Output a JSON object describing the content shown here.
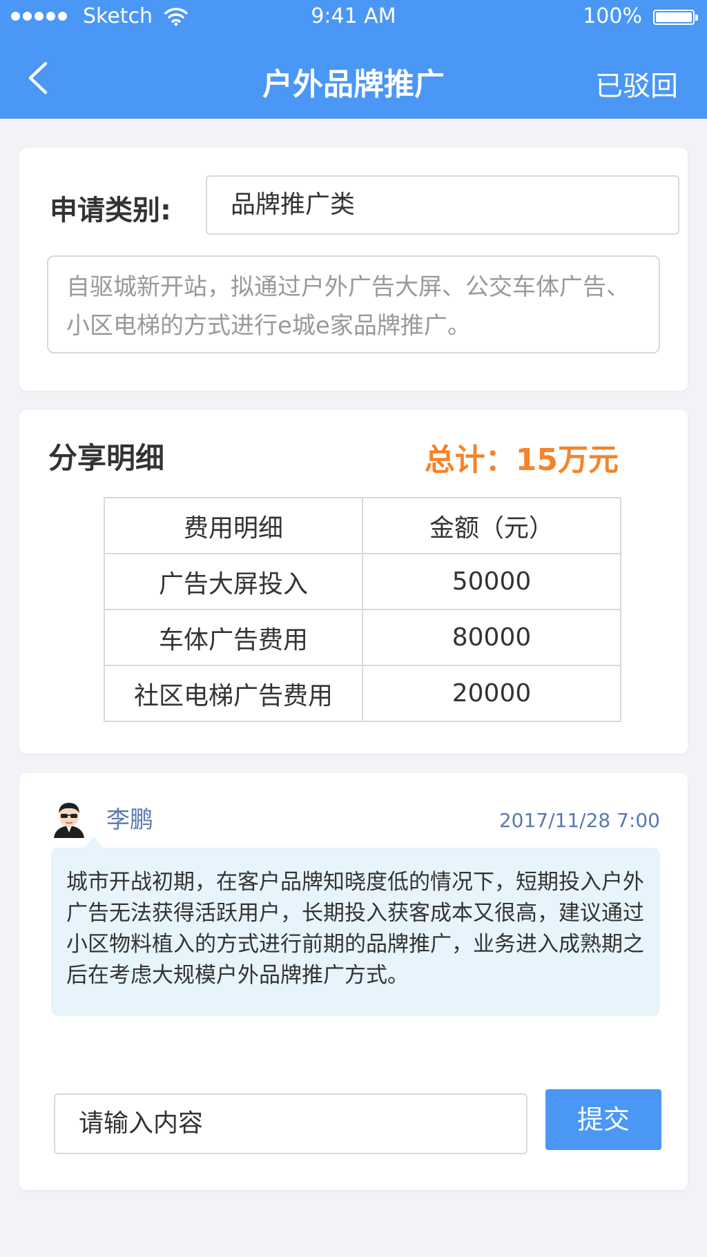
{
  "status_bar": {
    "carrier": "Sketch",
    "time": "9:41 AM",
    "battery": "100%"
  },
  "nav": {
    "title": "户外品牌推广",
    "right_action": "已驳回",
    "back_icon": "chevron-left-icon"
  },
  "application": {
    "category_label": "申请类别:",
    "category_value": "品牌推广类",
    "description": "自驱城新开站，拟通过户外广告大屏、公交车体广告、小区电梯的方式进行e城e家品牌推广。"
  },
  "share": {
    "title": "分享明细",
    "total": "总计：15万元",
    "headers": [
      "费用明细",
      "金额（元）"
    ],
    "rows": [
      [
        "广告大屏投入",
        "50000"
      ],
      [
        "车体广告费用",
        "80000"
      ],
      [
        "社区电梯广告费用",
        "20000"
      ]
    ]
  },
  "comment": {
    "user": "李鹏",
    "time": "2017/11/28 7:00",
    "text": "城市开战初期，在客户品牌知晓度低的情况下，短期投入户外广告无法获得活跃用户，长期投入获客成本又很高，建议通过小区物料植入的方式进行前期的品牌推广，业务进入成熟期之后在考虑大规模户外品牌推广方式。"
  },
  "input": {
    "placeholder": "请输入内容",
    "submit_label": "提交"
  },
  "colors": {
    "primary": "#4a97f5",
    "total_orange": "#f5842a",
    "bubble_bg": "#e8f4fc",
    "page_bg": "#f2f2f7"
  }
}
